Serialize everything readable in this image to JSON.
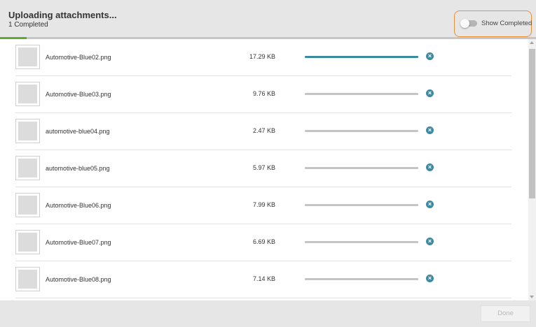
{
  "header": {
    "title": "Uploading attachments...",
    "status": "1 Completed",
    "overall_progress": 0.05
  },
  "toggle": {
    "label": "Show Completed",
    "checked": false,
    "highlight_color": "#e8913a"
  },
  "files": [
    {
      "name": "Automotive-Blue02.png",
      "size": "17.29 KB",
      "progress": 1.0,
      "active": true
    },
    {
      "name": "Automotive-Blue03.png",
      "size": "9.76 KB",
      "progress": 0,
      "active": false
    },
    {
      "name": "automotive-blue04.png",
      "size": "2.47 KB",
      "progress": 0,
      "active": false
    },
    {
      "name": "automotive-blue05.png",
      "size": "5.97 KB",
      "progress": 0,
      "active": false
    },
    {
      "name": "Automotive-Blue06.png",
      "size": "7.99 KB",
      "progress": 0,
      "active": false
    },
    {
      "name": "Automotive-Blue07.png",
      "size": "6.69 KB",
      "progress": 0,
      "active": false
    },
    {
      "name": "Automotive-Blue08.png",
      "size": "7.14 KB",
      "progress": 0,
      "active": false
    }
  ],
  "icons": {
    "cancel": "close-circle-icon",
    "thumbnail": "image-placeholder-icon"
  },
  "colors": {
    "overall_progress": "#5bab2d",
    "file_progress": "#3b8ba0",
    "cancel_icon": "#3e8aa2"
  },
  "footer": {
    "done_label": "Done",
    "done_enabled": false
  }
}
